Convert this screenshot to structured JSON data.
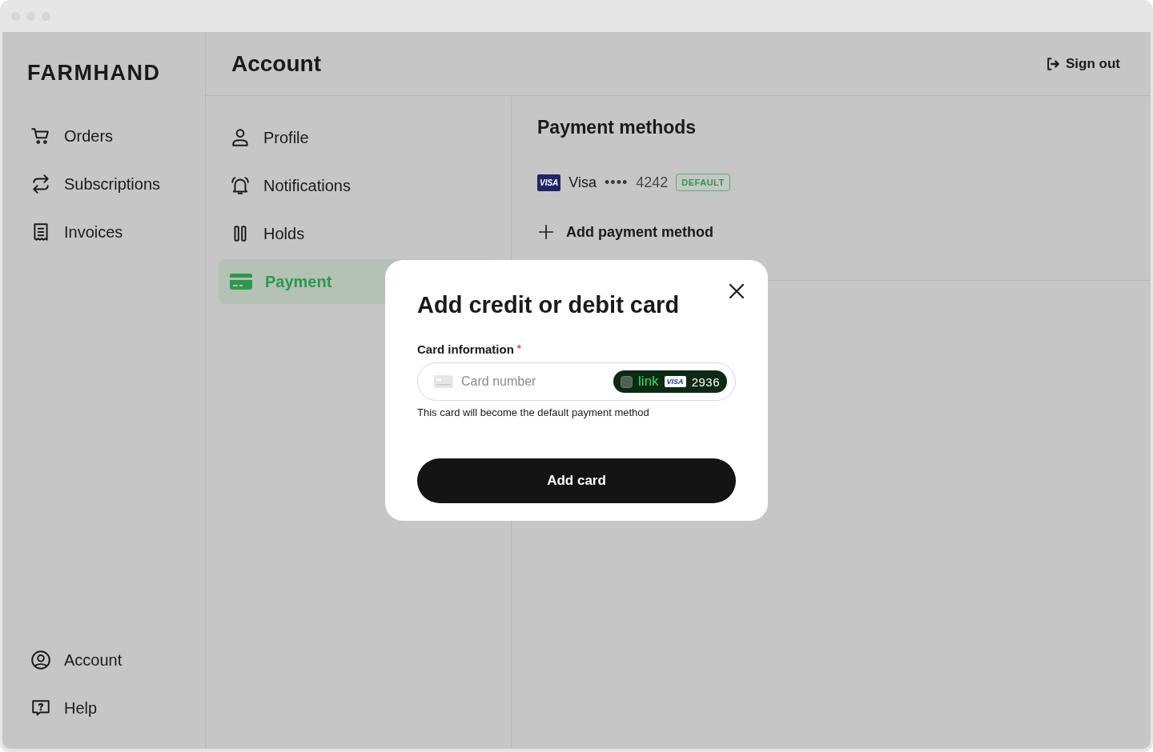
{
  "brand": "FARMHAND",
  "sidebar": {
    "top_items": [
      {
        "label": "Orders"
      },
      {
        "label": "Subscriptions"
      },
      {
        "label": "Invoices"
      }
    ],
    "bottom_items": [
      {
        "label": "Account"
      },
      {
        "label": "Help"
      }
    ]
  },
  "header": {
    "title": "Account",
    "sign_out": "Sign out"
  },
  "subnav": [
    {
      "label": "Profile",
      "selected": false
    },
    {
      "label": "Notifications",
      "selected": false
    },
    {
      "label": "Holds",
      "selected": false
    },
    {
      "label": "Payment",
      "selected": true
    }
  ],
  "payment_methods": {
    "title": "Payment methods",
    "methods": [
      {
        "brand_mark": "VISA",
        "name": "Visa",
        "dots": "••••",
        "last4": "4242",
        "badge": "DEFAULT"
      }
    ],
    "add_label": "Add payment method"
  },
  "modal": {
    "title": "Add credit or debit card",
    "field_label": "Card information",
    "required_mark": "*",
    "placeholder": "Card number",
    "link_badge": {
      "label": "link",
      "brand_mark": "VISA",
      "last4": "2936"
    },
    "hint": "This card will become the default payment method",
    "button": "Add card"
  }
}
